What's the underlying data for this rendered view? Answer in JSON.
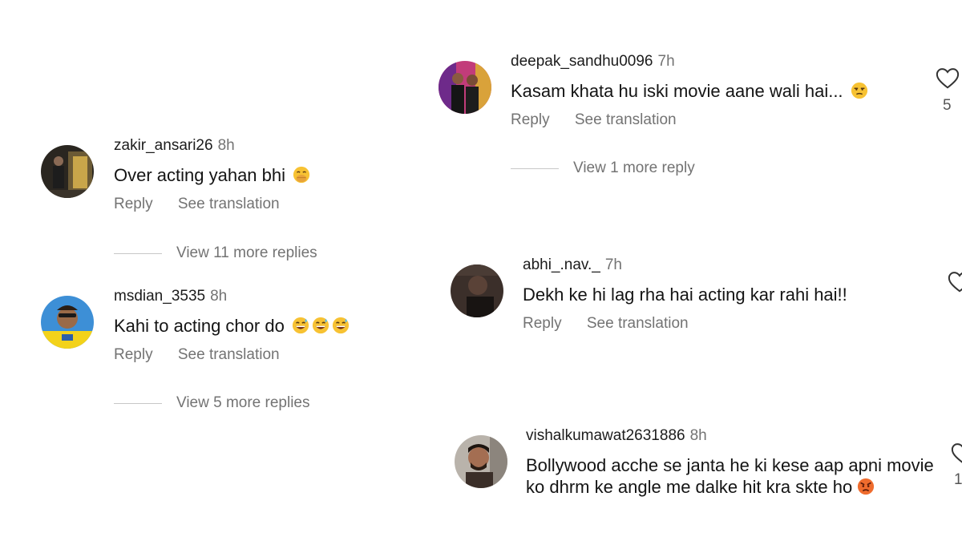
{
  "comments": [
    {
      "username": "zakir_ansari26",
      "time": "8h",
      "text": "Over acting yahan bhi",
      "emoji": [
        "face-with-hand-over-mouth"
      ],
      "reply_label": "Reply",
      "translate_label": "See translation",
      "view_replies": "View 11 more replies"
    },
    {
      "username": "msdian_3535",
      "time": "8h",
      "text": "Kahi to acting chor do",
      "emoji": [
        "grinning-sweat",
        "grinning-sweat",
        "grinning-sweat"
      ],
      "reply_label": "Reply",
      "translate_label": "See translation",
      "view_replies": "View 5 more replies"
    },
    {
      "username": "deepak_sandhu0096",
      "time": "7h",
      "text": "Kasam khata hu iski movie aane wali hai...",
      "emoji": [
        "unamused-face"
      ],
      "reply_label": "Reply",
      "translate_label": "See translation",
      "view_replies": "View 1 more reply",
      "likes": "5"
    },
    {
      "username": "abhi_.nav._",
      "time": "7h",
      "text": "Dekh ke hi lag rha hai acting kar rahi hai!!",
      "reply_label": "Reply",
      "translate_label": "See translation"
    },
    {
      "username": "vishalkumawat2631886",
      "time": "8h",
      "text": "Bollywood acche se janta he ki kese aap apni movie ko dhrm ke angle me dalke hit kra skte ho",
      "emoji": [
        "angry-face"
      ],
      "likes_partial": "1"
    }
  ],
  "colors": {
    "text": "#141414",
    "secondary": "#737373",
    "divider": "#c7c7c7",
    "emoji_yellow": "#f7c233"
  }
}
